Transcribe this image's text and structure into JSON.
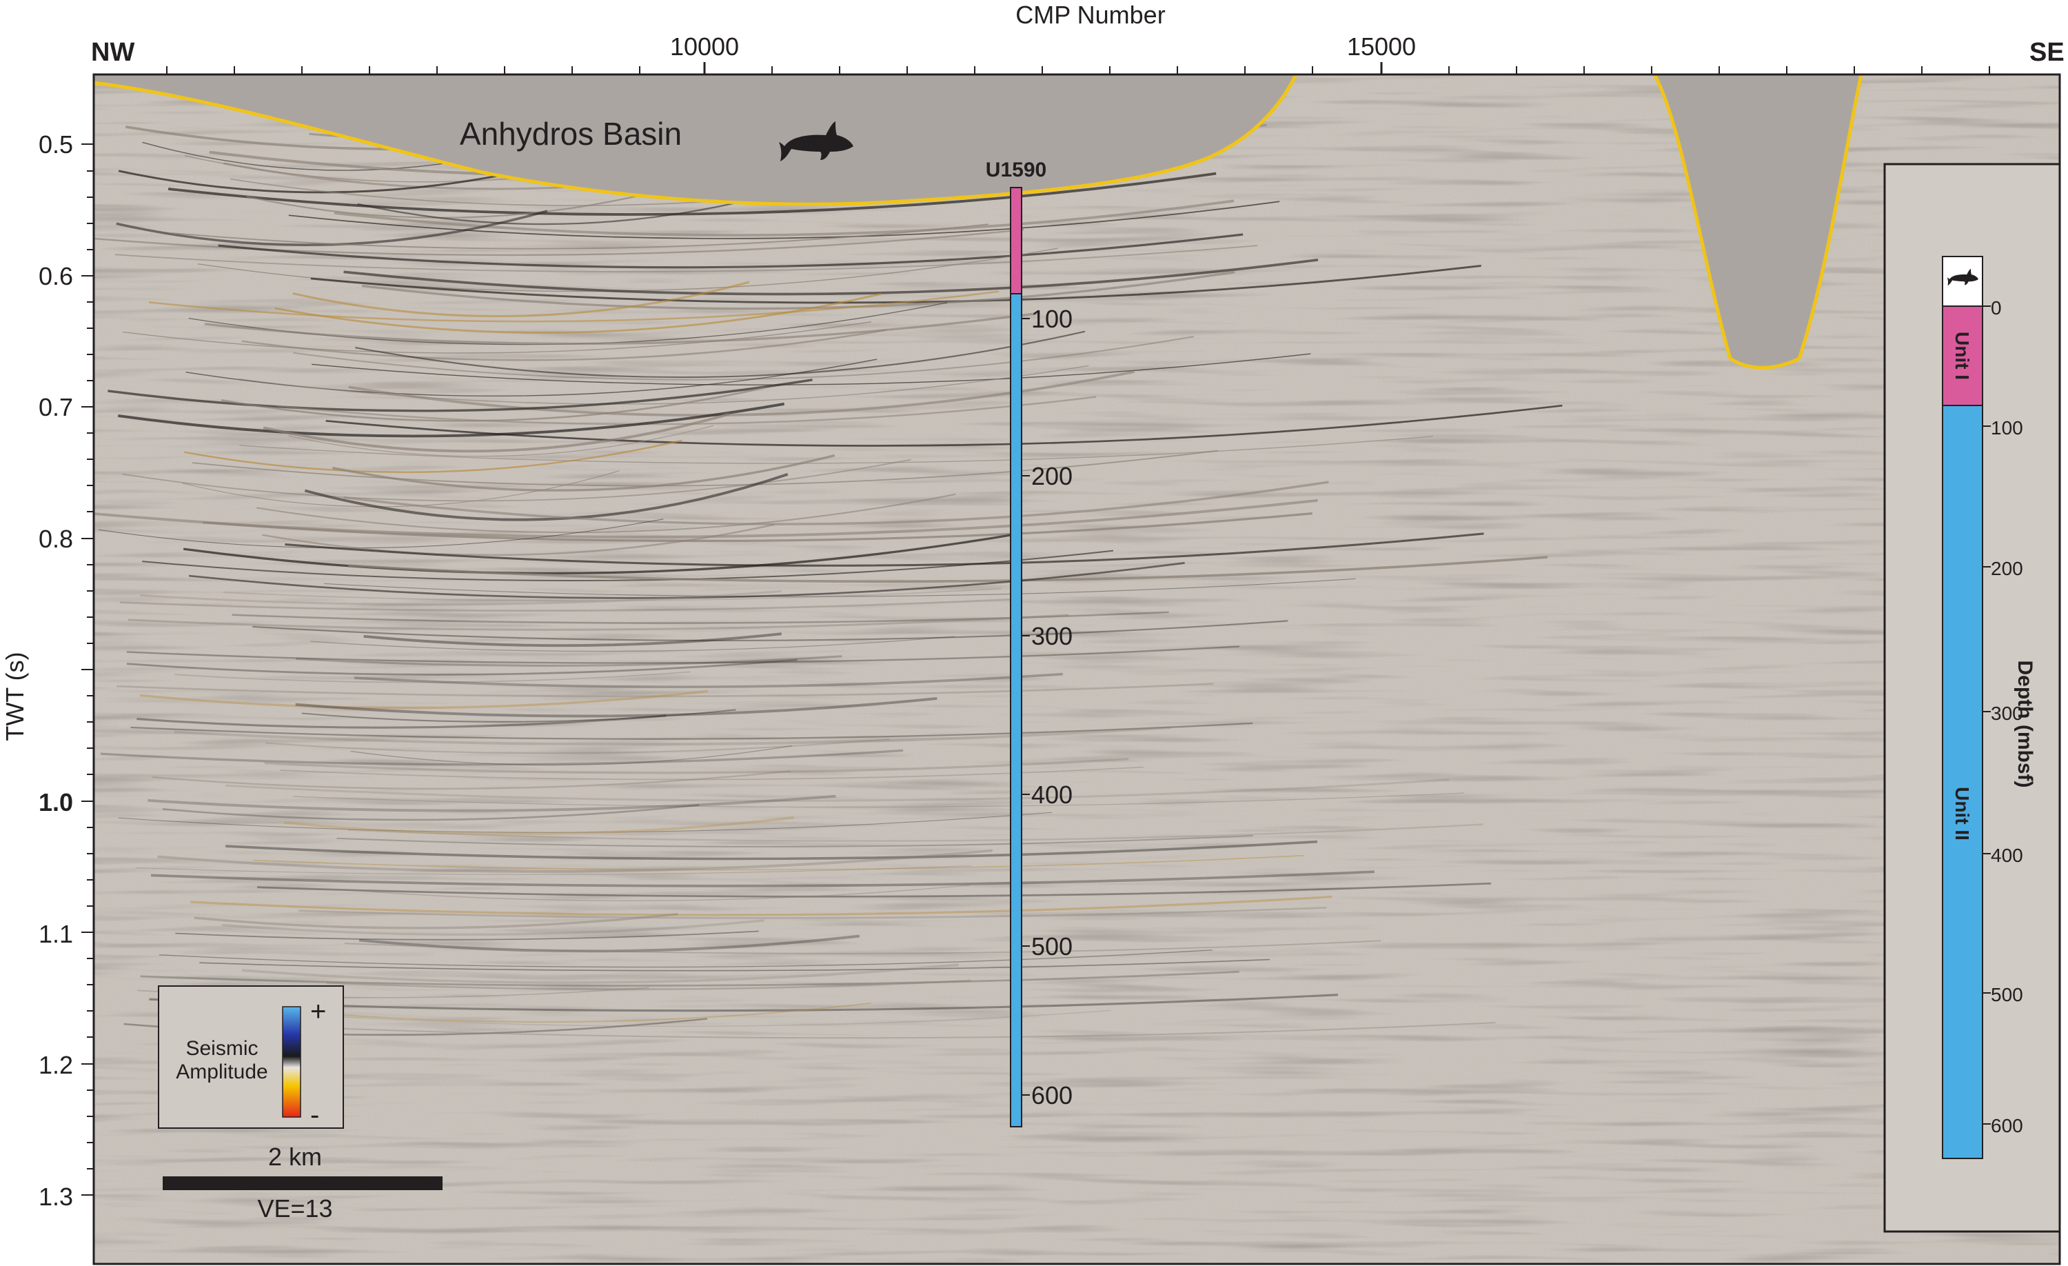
{
  "figure": {
    "x_axis_title": "CMP Number",
    "x_ticks": [
      "10000",
      "15000"
    ],
    "direction_left": "NW",
    "direction_right": "SE",
    "y_axis_title": "TWT (s)",
    "y_ticks": [
      "0.5",
      "0.6",
      "0.7",
      "0.8",
      "1.0",
      "1.1",
      "1.2",
      "1.3"
    ],
    "basin_label": "Anhydros Basin",
    "site_label": "U1590",
    "depth_ticks": [
      "100",
      "200",
      "300",
      "400",
      "500",
      "600"
    ]
  },
  "legend": {
    "title_line1": "Seismic",
    "title_line2": "Amplitude",
    "plus": "+",
    "minus": "-",
    "scale_label": "2 km",
    "ve_label": "VE=13"
  },
  "inset": {
    "depth_label": "Depth (mbsf)",
    "depth_ticks": [
      "0",
      "100",
      "200",
      "300",
      "400",
      "500",
      "600"
    ],
    "unit1": "Unit I",
    "unit2": "Unit II"
  },
  "colors": {
    "water": "#aba5a1",
    "seismic_bg": "#c9c3bc",
    "unit1": "#d95b9c",
    "unit2": "#4aaee4",
    "reflector_yellow": "#f0c419",
    "reflector_dark": "#2a2522"
  },
  "icons": {
    "shark": "shark-icon"
  }
}
